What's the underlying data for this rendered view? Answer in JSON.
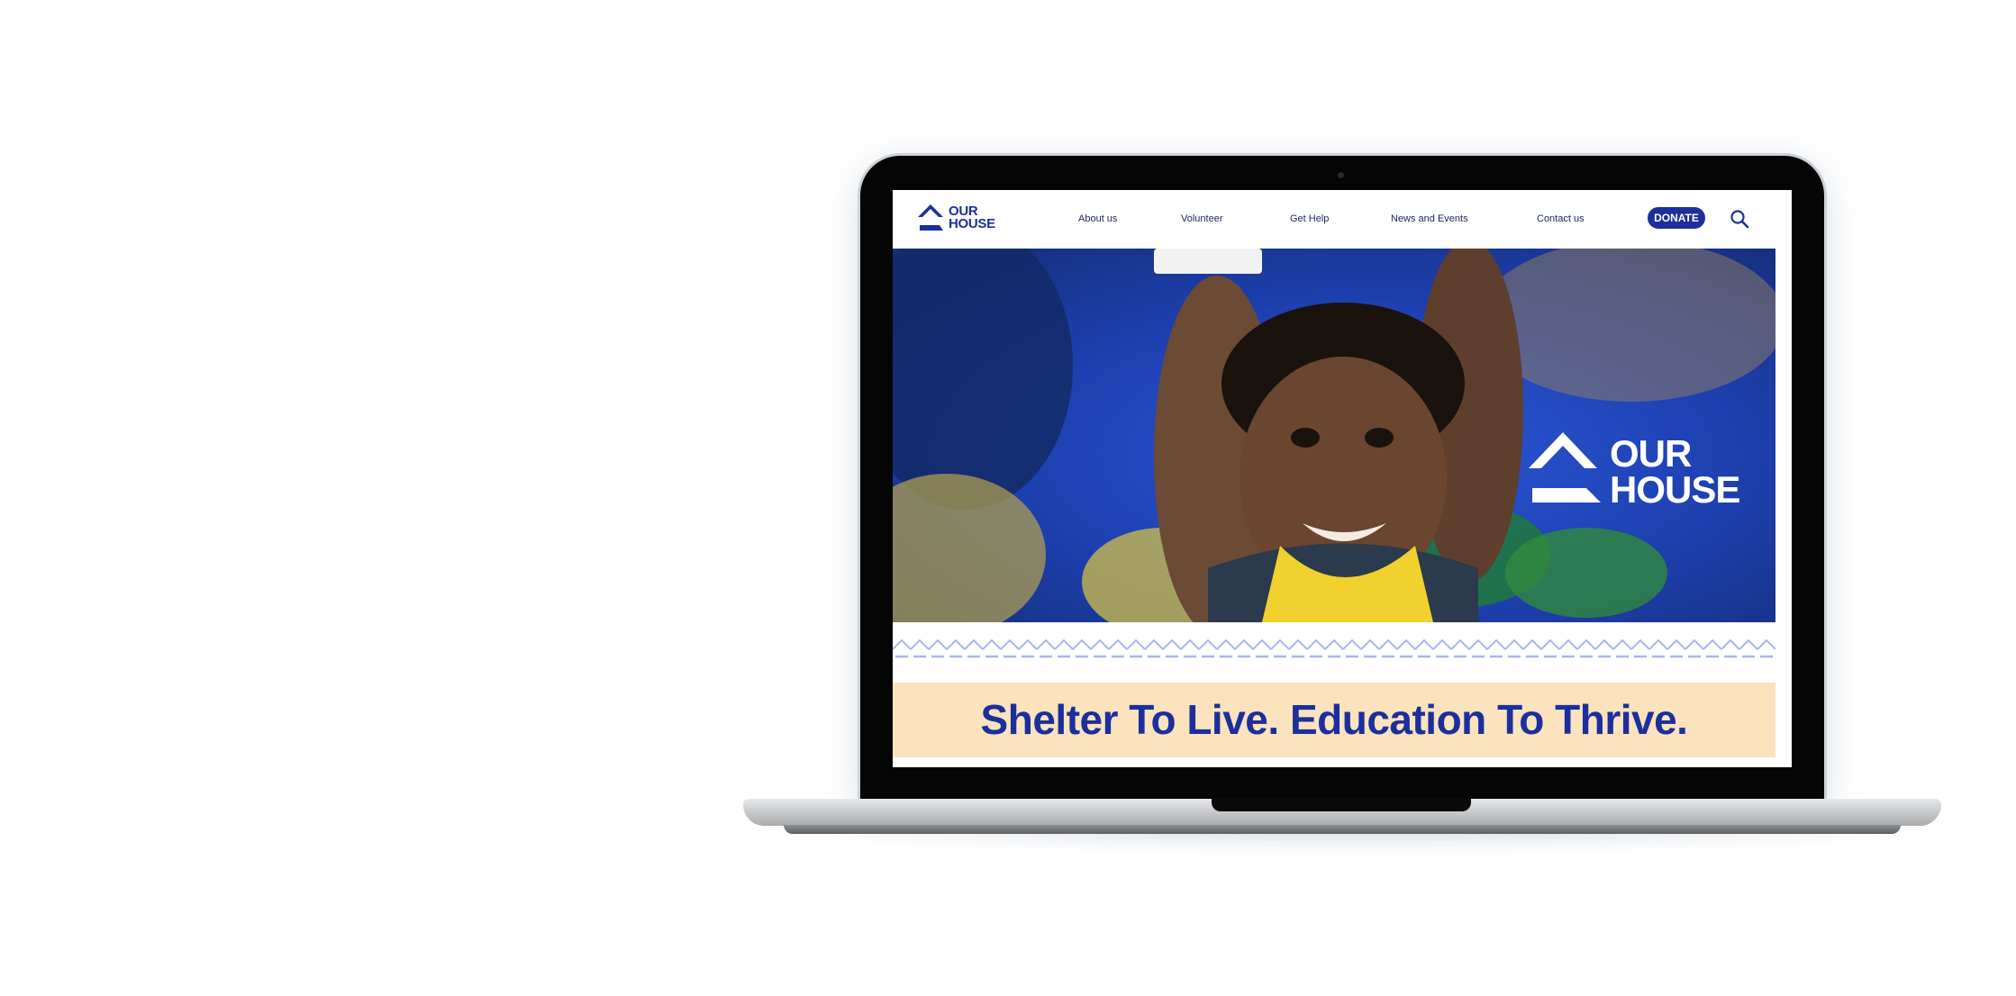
{
  "brand": {
    "line1": "OUR",
    "line2": "HOUSE",
    "primary_color": "#1c2f9c",
    "accent_color": "#fbe3bd"
  },
  "nav": {
    "items": [
      {
        "label": "About us"
      },
      {
        "label": "Volunteer"
      },
      {
        "label": "Get Help"
      },
      {
        "label": "News and Events"
      },
      {
        "label": "Contact us"
      }
    ],
    "donate_label": "DONATE",
    "search_icon": "search-icon"
  },
  "hero": {
    "image_alt": "Smiling child holding a book on his head",
    "logo_line1": "OUR",
    "logo_line2": "HOUSE"
  },
  "tagline": "Shelter To Live. Education To Thrive."
}
